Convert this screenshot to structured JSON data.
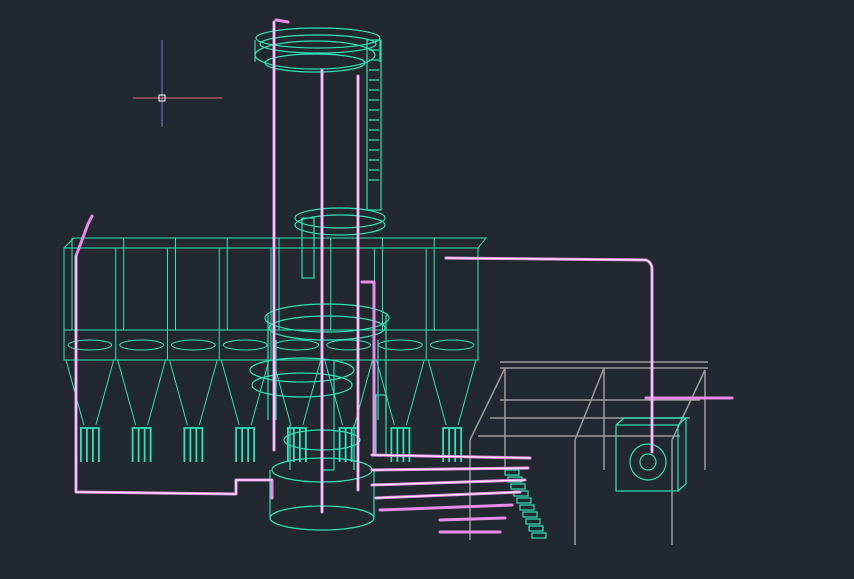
{
  "colors": {
    "background": "#212830",
    "structure": "#2de3b8",
    "pipe": "#e68ce8",
    "pipe_inner": "#ffffff",
    "frame": "#9a9a9a",
    "ucs_x": "#d96a7a",
    "ucs_y": "#7a7ae0"
  },
  "drawing": {
    "hopper_bins": 8,
    "hopper_legs_per_bin": 4,
    "frame_bays": 3,
    "crosshair_icon": "crosshair-cursor-icon"
  }
}
